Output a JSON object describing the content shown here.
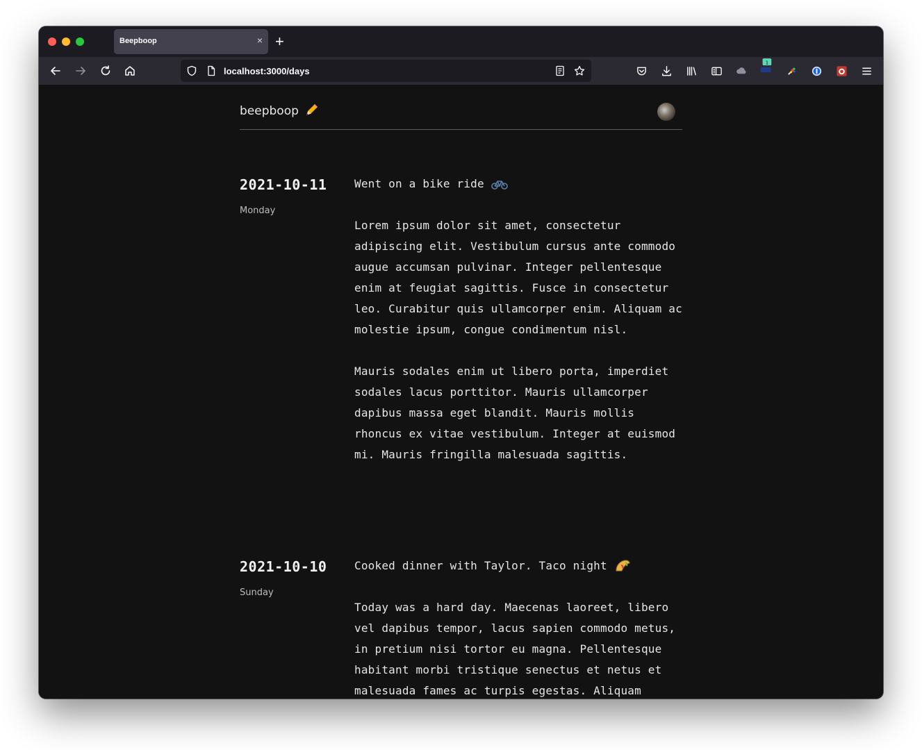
{
  "browser": {
    "tab_title": "Beepboop",
    "tab_close": "×",
    "new_tab": "+",
    "url": "localhost:3000/days"
  },
  "site": {
    "brand": "beepboop"
  },
  "entries": [
    {
      "date": "2021-10-11",
      "day": "Monday",
      "title": "Went on a bike ride",
      "title_icon": "bicycle-icon",
      "paragraphs": [
        "Lorem ipsum dolor sit amet, consectetur adipiscing elit. Vestibulum cursus ante commodo augue accumsan pulvinar. Integer pellentesque enim at feugiat sagittis. Fusce in consectetur leo. Curabitur quis ullamcorper enim. Aliquam ac molestie ipsum, congue condimentum nisl.",
        "Mauris sodales enim ut libero porta, imperdiet sodales lacus porttitor. Mauris ullamcorper dapibus massa eget blandit. Mauris mollis rhoncus ex vitae vestibulum. Integer at euismod mi. Mauris fringilla malesuada sagittis."
      ]
    },
    {
      "date": "2021-10-10",
      "day": "Sunday",
      "title": "Cooked dinner with Taylor. Taco night",
      "title_icon": "taco-icon",
      "paragraphs": [
        "Today was a hard day. Maecenas laoreet, libero vel dapibus tempor, lacus sapien commodo metus, in pretium nisi tortor eu magna. Pellentesque habitant morbi tristique senectus et netus et malesuada fames ac turpis egestas. Aliquam"
      ]
    }
  ]
}
